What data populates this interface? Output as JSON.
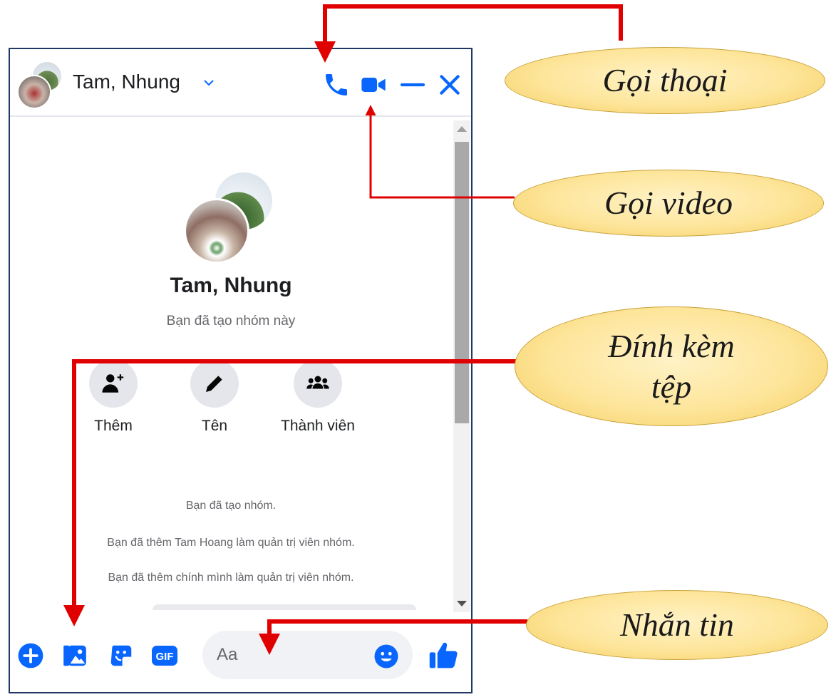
{
  "header": {
    "title": "Tam, Nhung"
  },
  "group": {
    "name": "Tam, Nhung",
    "subtitle": "Bạn đã tạo nhóm này"
  },
  "actions": [
    {
      "label": "Thêm",
      "icon": "add-person-icon"
    },
    {
      "label": "Tên",
      "icon": "pencil-icon"
    },
    {
      "label": "Thành viên",
      "icon": "group-members-icon"
    }
  ],
  "system_messages": [
    "Bạn đã tạo nhóm.",
    "Bạn đã thêm Tam Hoang làm quản trị viên nhóm.",
    "Bạn đã thêm chính mình làm quản trị viên nhóm."
  ],
  "composer": {
    "placeholder": "Aa",
    "gif_label": "GIF"
  },
  "callouts": {
    "voice_call": "Gọi thoại",
    "video_call": "Gọi video",
    "attach_line1": "Đính kèm",
    "attach_line2": "tệp",
    "message": "Nhắn tin"
  },
  "colors": {
    "accent": "#0866ff",
    "arrow": "#e00000",
    "callout_fill": "#fde59a",
    "window_border": "#1f3864"
  }
}
